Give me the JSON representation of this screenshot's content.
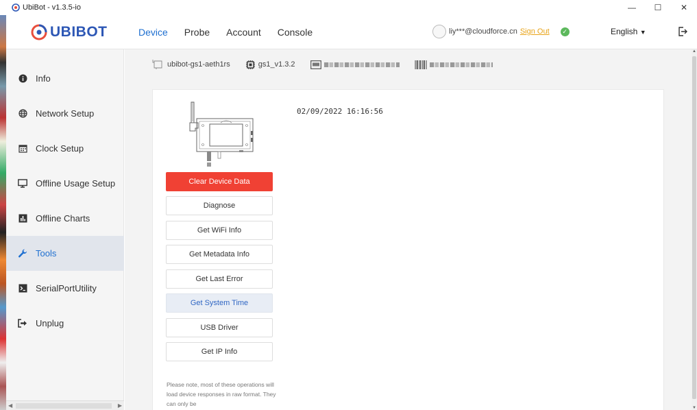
{
  "window": {
    "title": "UbiBot - v1.3.5-io",
    "controls": {
      "minimize": "—",
      "maximize": "☐",
      "close": "✕"
    }
  },
  "header": {
    "logo_text": "UBIBOT",
    "nav": [
      "Device",
      "Probe",
      "Account",
      "Console"
    ],
    "active_nav": "Device",
    "user_email": "liy***@cloudforce.cn",
    "sign_out": "Sign Out",
    "connection_status": "connected",
    "language": "English",
    "icons": {
      "logo": "ubibot-logo-icon",
      "status": "check-circle-icon",
      "exit": "exit-icon"
    }
  },
  "sidebar": {
    "items": [
      {
        "label": "Info",
        "icon": "info-icon",
        "active": false
      },
      {
        "label": "Network Setup",
        "icon": "globe-icon",
        "active": false
      },
      {
        "label": "Clock Setup",
        "icon": "calendar-icon",
        "active": false
      },
      {
        "label": "Offline Usage Setup",
        "icon": "monitor-icon",
        "active": false
      },
      {
        "label": "Offline Charts",
        "icon": "bar-chart-icon",
        "active": false
      },
      {
        "label": "Tools",
        "icon": "wrench-icon",
        "active": true
      },
      {
        "label": "SerialPortUtility",
        "icon": "terminal-icon",
        "active": false
      },
      {
        "label": "Unplug",
        "icon": "unplug-icon",
        "active": false
      }
    ]
  },
  "device_bar": {
    "device_name": "ubibot-gs1-aeth1rs",
    "firmware": "gs1_v1.3.2"
  },
  "panel": {
    "timestamp": "02/09/2022 16:16:56",
    "buttons": [
      {
        "label": "Clear Device Data",
        "style": "danger"
      },
      {
        "label": "Diagnose",
        "style": "default"
      },
      {
        "label": "Get WiFi Info",
        "style": "default"
      },
      {
        "label": "Get Metadata Info",
        "style": "default"
      },
      {
        "label": "Get Last Error",
        "style": "default"
      },
      {
        "label": "Get System Time",
        "style": "selected"
      },
      {
        "label": "USB Driver",
        "style": "default"
      },
      {
        "label": "Get IP Info",
        "style": "default"
      }
    ],
    "note": "Please note, most of these operations will load device responses in raw format. They can only be"
  },
  "colors": {
    "accent": "#1e6fd0",
    "brand": "#2d57b5",
    "danger": "#f04134",
    "signout": "#e8a317",
    "status_ok": "#5cb85c"
  }
}
